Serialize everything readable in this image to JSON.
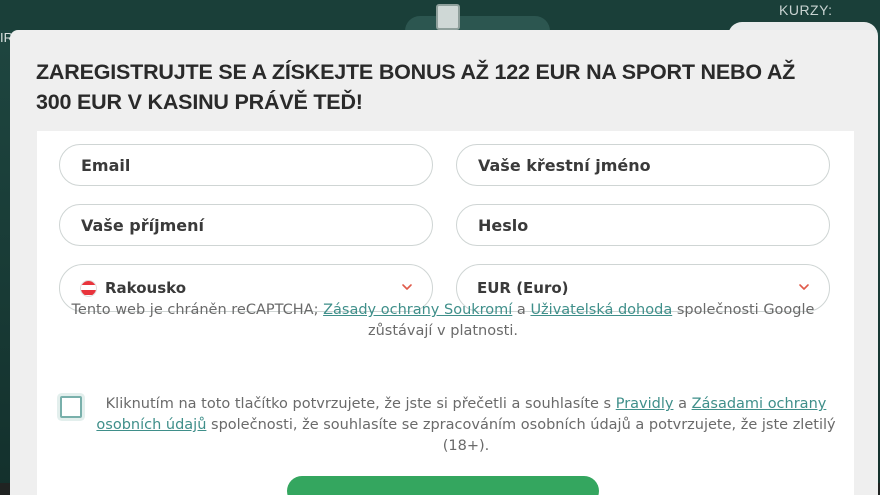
{
  "background": {
    "kurzy_label": "KURZY:",
    "left_fragment": "IR"
  },
  "modal": {
    "title": "ZAREGISTRUJTE SE A ZÍSKEJTE BONUS AŽ 122 EUR NA SPORT NEBO AŽ 300 EUR V KASINU PRÁVĚ TEĎ!"
  },
  "form": {
    "email_placeholder": "Email",
    "first_name_placeholder": "Vaše křestní jméno",
    "last_name_placeholder": "Vaše příjmení",
    "password_placeholder": "Heslo",
    "country_selected": "Rakousko",
    "currency_selected": "EUR (Euro)"
  },
  "recaptcha": {
    "prefix": "Tento web je chráněn reCAPTCHA; ",
    "privacy_link": "Zásady ochrany Soukromí",
    "and": " a ",
    "terms_link": "Uživatelská dohoda",
    "suffix": " společnosti Google zůstávají v platnosti."
  },
  "consent": {
    "prefix": "Kliknutím na toto tlačítko potvrzujete, že jste si přečetli a souhlasíte s ",
    "rules_link": "Pravidly",
    "and": " a ",
    "privacy_link": "Zásadami ochrany osobních údajů",
    "suffix": " společnosti, že souhlasíte se zpracováním osobních údajů a potvrzujete, že jste zletilý (18+)."
  },
  "colors": {
    "accent": "#3f8f8a",
    "submit": "#34a65f",
    "flag_red": "#e8343c",
    "chevron": "#e05a4a"
  }
}
